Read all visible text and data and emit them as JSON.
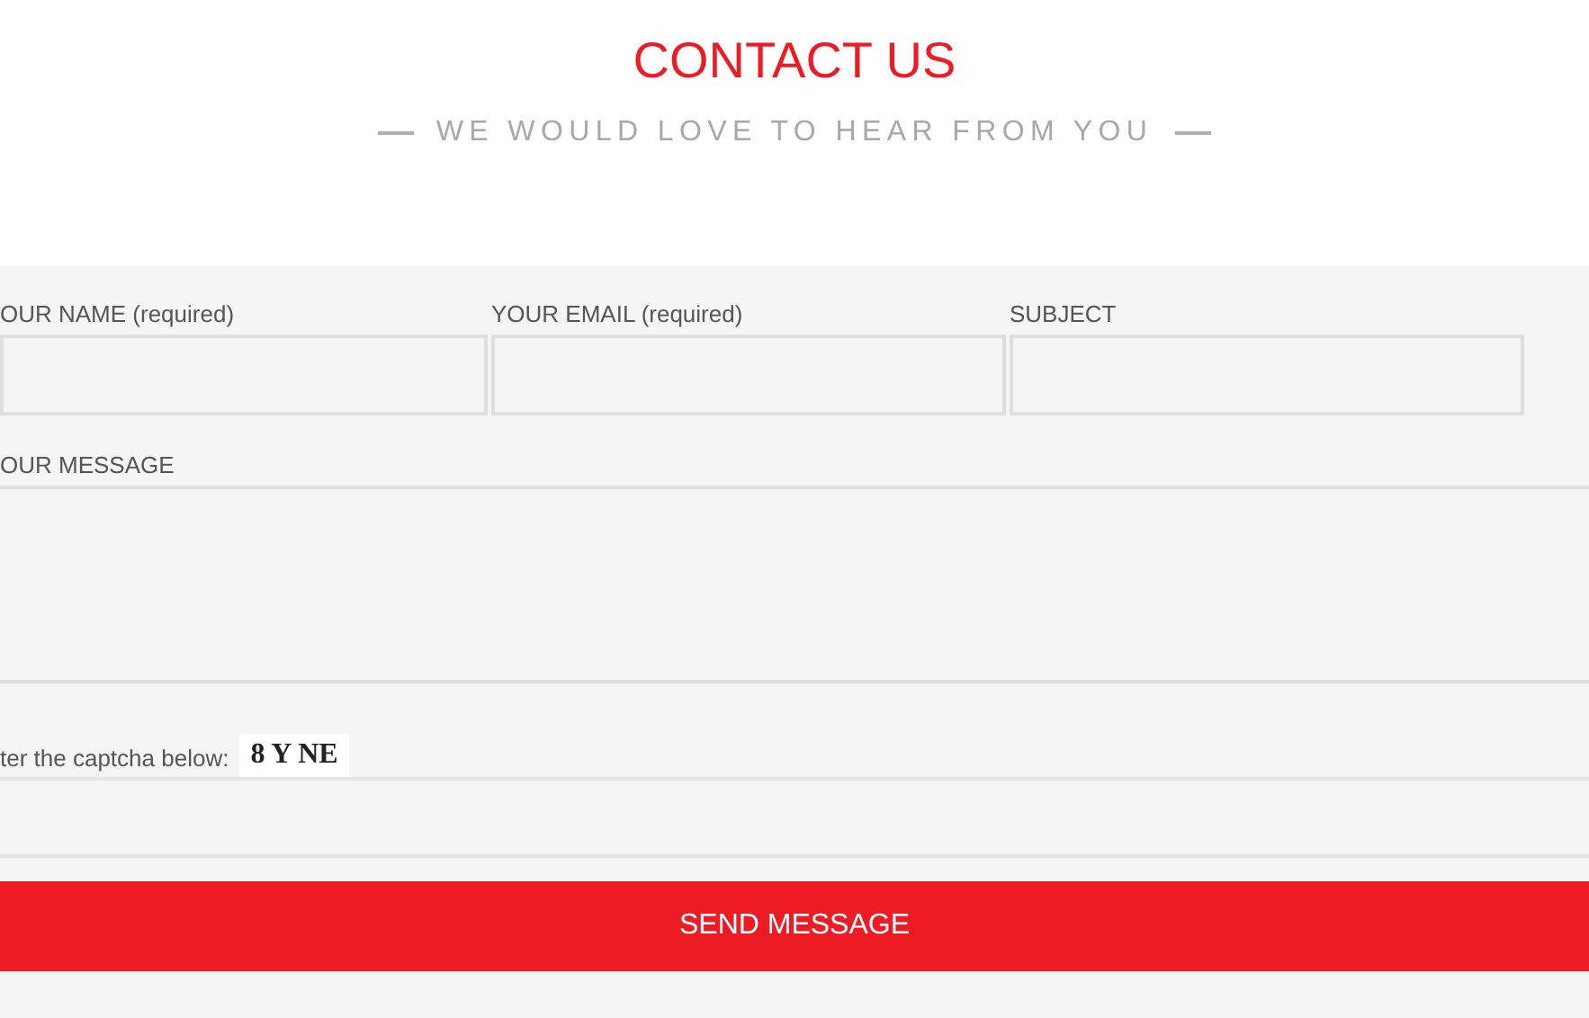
{
  "heading": {
    "title": "CONTACT US",
    "subtitle": "WE WOULD LOVE TO HEAR FROM YOU"
  },
  "fields": [
    {
      "label": "OUR NAME (required)"
    },
    {
      "label": "YOUR EMAIL (required)"
    },
    {
      "label": "SUBJECT"
    }
  ],
  "message": {
    "label": "OUR MESSAGE"
  },
  "captcha": {
    "label": "ter the captcha below:",
    "code": "8 Y NE"
  },
  "submit": {
    "label": "SEND MESSAGE"
  }
}
